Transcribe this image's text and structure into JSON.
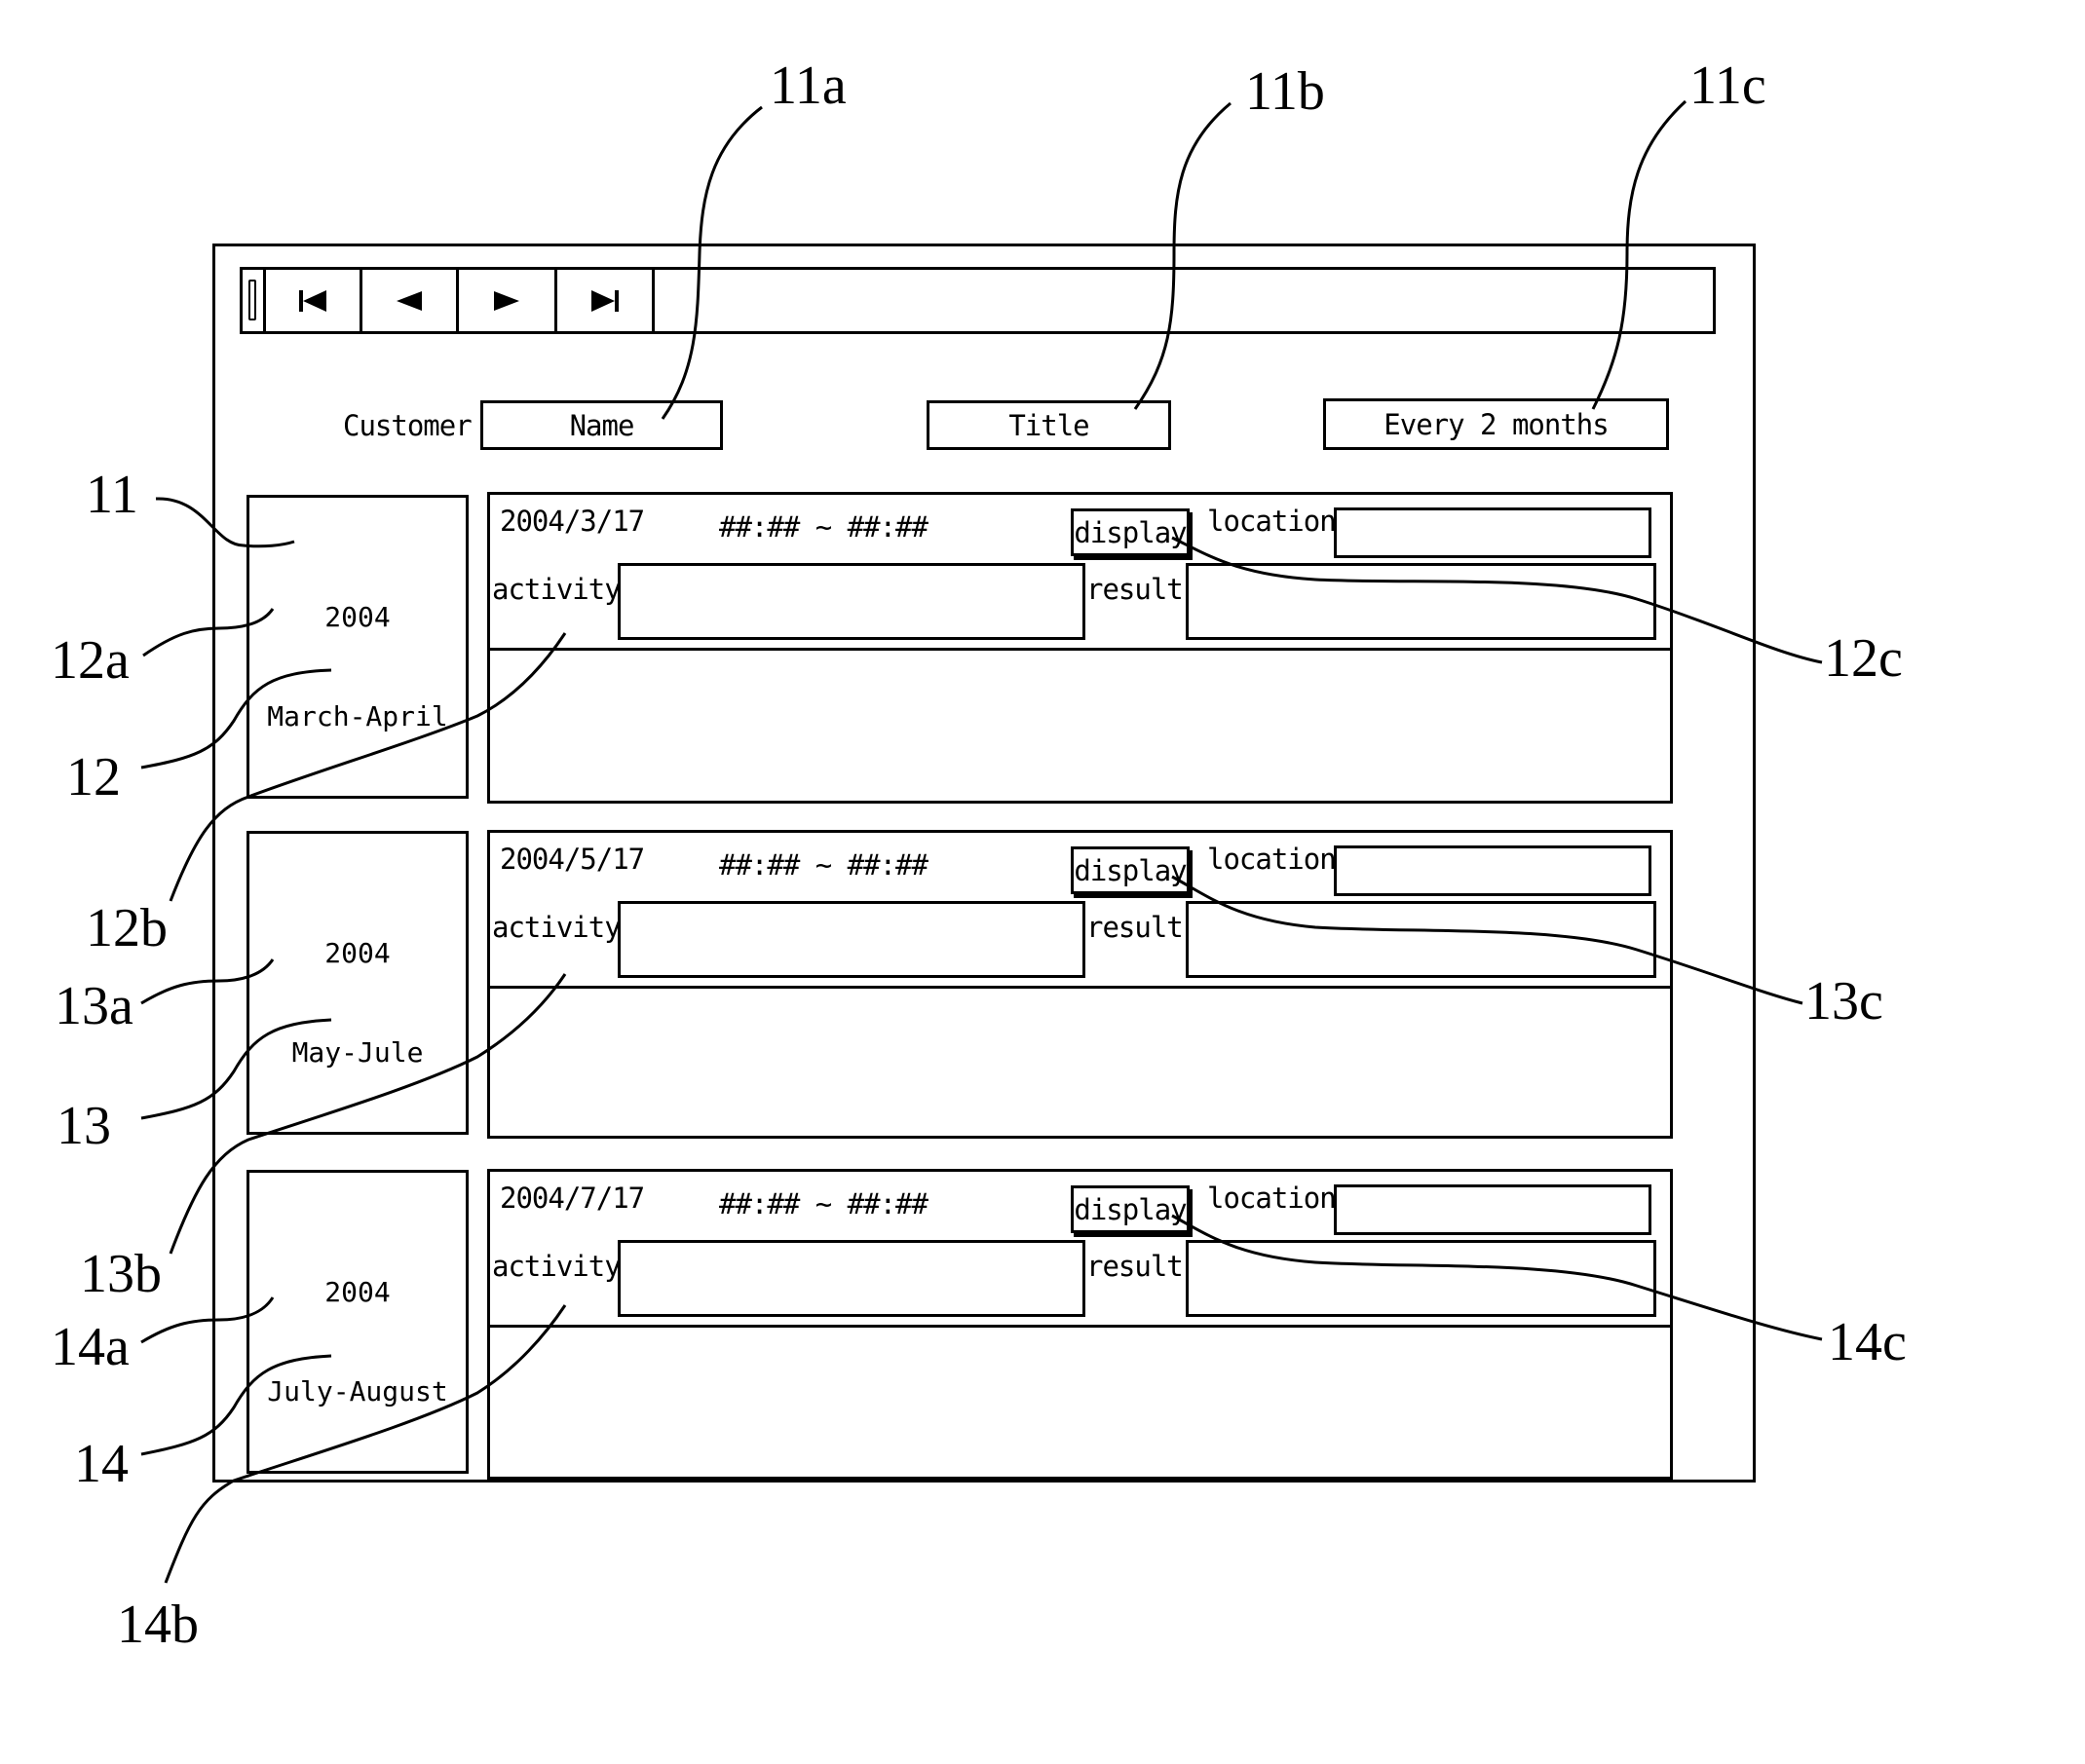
{
  "toolbar": {
    "buttons": [
      {
        "name": "first-record",
        "icon": "skip-to-first-icon",
        "glyph": "⏮"
      },
      {
        "name": "previous-record",
        "icon": "previous-icon",
        "glyph": "◀"
      },
      {
        "name": "next-record",
        "icon": "next-icon",
        "glyph": "▶"
      },
      {
        "name": "last-record",
        "icon": "skip-to-last-icon",
        "glyph": "⏭"
      }
    ]
  },
  "header": {
    "customer_label": "Customer",
    "name_value": "Name",
    "title_value": "Title",
    "frequency_value": "Every 2 months"
  },
  "records": [
    {
      "period": {
        "year": "2004",
        "months": "March-April"
      },
      "date": "2004/3/17",
      "time_range": "##:## ~ ##:##",
      "display_label": "display",
      "location_label": "location",
      "location_value": "",
      "activity_label": "activity",
      "activity_value": "",
      "result_label": "result",
      "result_value": ""
    },
    {
      "period": {
        "year": "2004",
        "months": "May-Jule"
      },
      "date": "2004/5/17",
      "time_range": "##:## ~ ##:##",
      "display_label": "display",
      "location_label": "location",
      "location_value": "",
      "activity_label": "activity",
      "activity_value": "",
      "result_label": "result",
      "result_value": ""
    },
    {
      "period": {
        "year": "2004",
        "months": "July-August"
      },
      "date": "2004/7/17",
      "time_range": "##:## ~ ##:##",
      "display_label": "display",
      "location_label": "location",
      "location_value": "",
      "activity_label": "activity",
      "activity_value": "",
      "result_label": "result",
      "result_value": ""
    }
  ],
  "reference_labels": {
    "r11a": "11a",
    "r11b": "11b",
    "r11c": "11c",
    "r11": "11",
    "r12a": "12a",
    "r12": "12",
    "r12b": "12b",
    "r12c": "12c",
    "r13a": "13a",
    "r13": "13",
    "r13b": "13b",
    "r13c": "13c",
    "r14a": "14a",
    "r14": "14",
    "r14b": "14b",
    "r14c": "14c"
  }
}
